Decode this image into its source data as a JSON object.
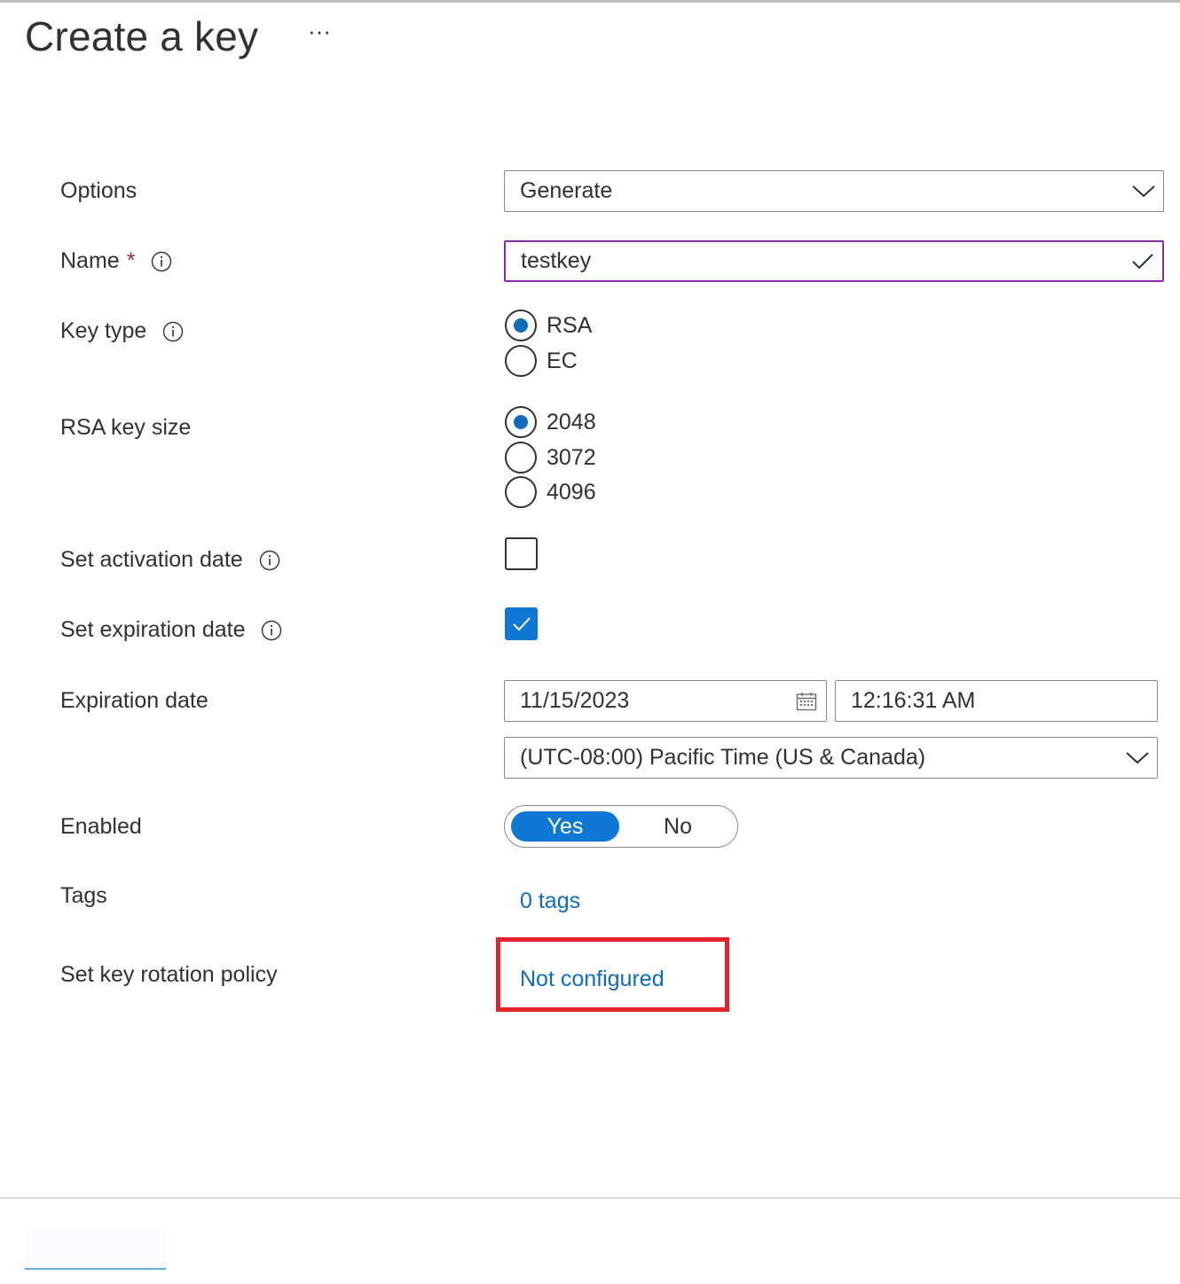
{
  "header": {
    "title": "Create a key",
    "more_label": "···"
  },
  "form": {
    "options": {
      "label": "Options",
      "value": "Generate",
      "icon": "chevron-down-icon"
    },
    "name": {
      "label": "Name",
      "required_marker": "*",
      "value": "testkey",
      "icon": "checkmark-icon"
    },
    "key_type": {
      "label": "Key type",
      "options": [
        "RSA",
        "EC"
      ],
      "selected": "RSA"
    },
    "rsa_key_size": {
      "label": "RSA key size",
      "options": [
        "2048",
        "3072",
        "4096"
      ],
      "selected": "2048"
    },
    "activation_date": {
      "label": "Set activation date",
      "checked": false
    },
    "expiration_date_toggle": {
      "label": "Set expiration date",
      "checked": true
    },
    "expiration_date": {
      "label": "Expiration date",
      "date": "11/15/2023",
      "time": "12:16:31 AM",
      "timezone": "(UTC-08:00) Pacific Time (US & Canada)"
    },
    "enabled": {
      "label": "Enabled",
      "yes": "Yes",
      "no": "No",
      "selected": "Yes"
    },
    "tags": {
      "label": "Tags",
      "link": "0 tags"
    },
    "rotation_policy": {
      "label": "Set key rotation policy",
      "link": "Not configured"
    }
  },
  "colors": {
    "accent": "#0f6cbd",
    "toggle_on": "#0f78d4",
    "required": "#a4262c",
    "name_border": "#8a2ba8",
    "highlight": "#e3222a"
  }
}
